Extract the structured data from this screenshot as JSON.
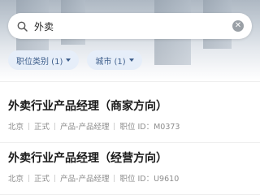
{
  "search": {
    "value": "外卖"
  },
  "filters": [
    {
      "label": "职位类别 (1)"
    },
    {
      "label": "城市 (1)"
    }
  ],
  "jobs": [
    {
      "title": "外卖行业产品经理（商家方向）",
      "city": "北京",
      "type": "正式",
      "category": "产品-产品经理",
      "job_id": "职位 ID：M0373"
    },
    {
      "title": "外卖行业产品经理（经营方向）",
      "city": "北京",
      "type": "正式",
      "category": "产品-产品经理",
      "job_id": "职位 ID：U9610"
    }
  ],
  "icons": {
    "search": "search-icon",
    "clear": "clear-icon",
    "dropdown": "chevron-down-icon"
  },
  "colors": {
    "chip_bg": "#e6eef9",
    "chip_text": "#3f5f8c",
    "title_text": "#1a1a1a",
    "meta_text": "#8c8c8c"
  }
}
